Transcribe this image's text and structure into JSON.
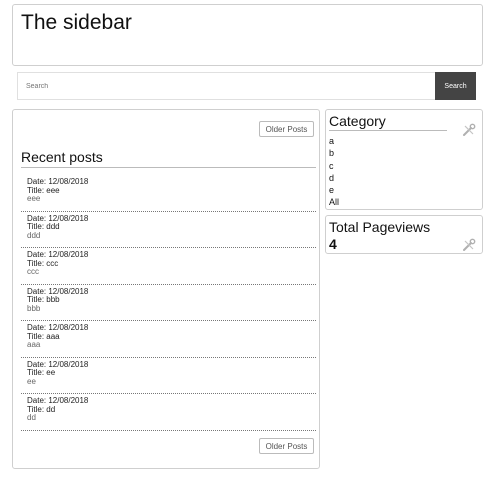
{
  "header": {
    "title": "The sidebar"
  },
  "search": {
    "placeholder": "Search",
    "button_label": "Search"
  },
  "main": {
    "older_posts_label": "Older Posts",
    "recent_title": "Recent posts",
    "posts": [
      {
        "date": "Date: 12/08/2018",
        "title": "Title: eee",
        "body": "eee"
      },
      {
        "date": "Date: 12/08/2018",
        "title": "Title: ddd",
        "body": "ddd"
      },
      {
        "date": "Date: 12/08/2018",
        "title": "Title: ccc",
        "body": "ccc"
      },
      {
        "date": "Date: 12/08/2018",
        "title": "Title: bbb",
        "body": "bbb"
      },
      {
        "date": "Date: 12/08/2018",
        "title": "Title: aaa",
        "body": "aaa"
      },
      {
        "date": "Date: 12/08/2018",
        "title": "Title: ee",
        "body": "ee"
      },
      {
        "date": "Date: 12/08/2018",
        "title": "Title: dd",
        "body": "dd"
      }
    ]
  },
  "sidebar": {
    "category": {
      "title": "Category",
      "items": [
        "a",
        "b",
        "c",
        "d",
        "e",
        "All"
      ],
      "icon": "wrench-screwdriver-icon"
    },
    "pageviews": {
      "title": "Total Pageviews",
      "count": "4",
      "icon": "wrench-screwdriver-icon"
    }
  },
  "colors": {
    "search_button_bg": "#444444",
    "border": "#cfcfcf"
  }
}
